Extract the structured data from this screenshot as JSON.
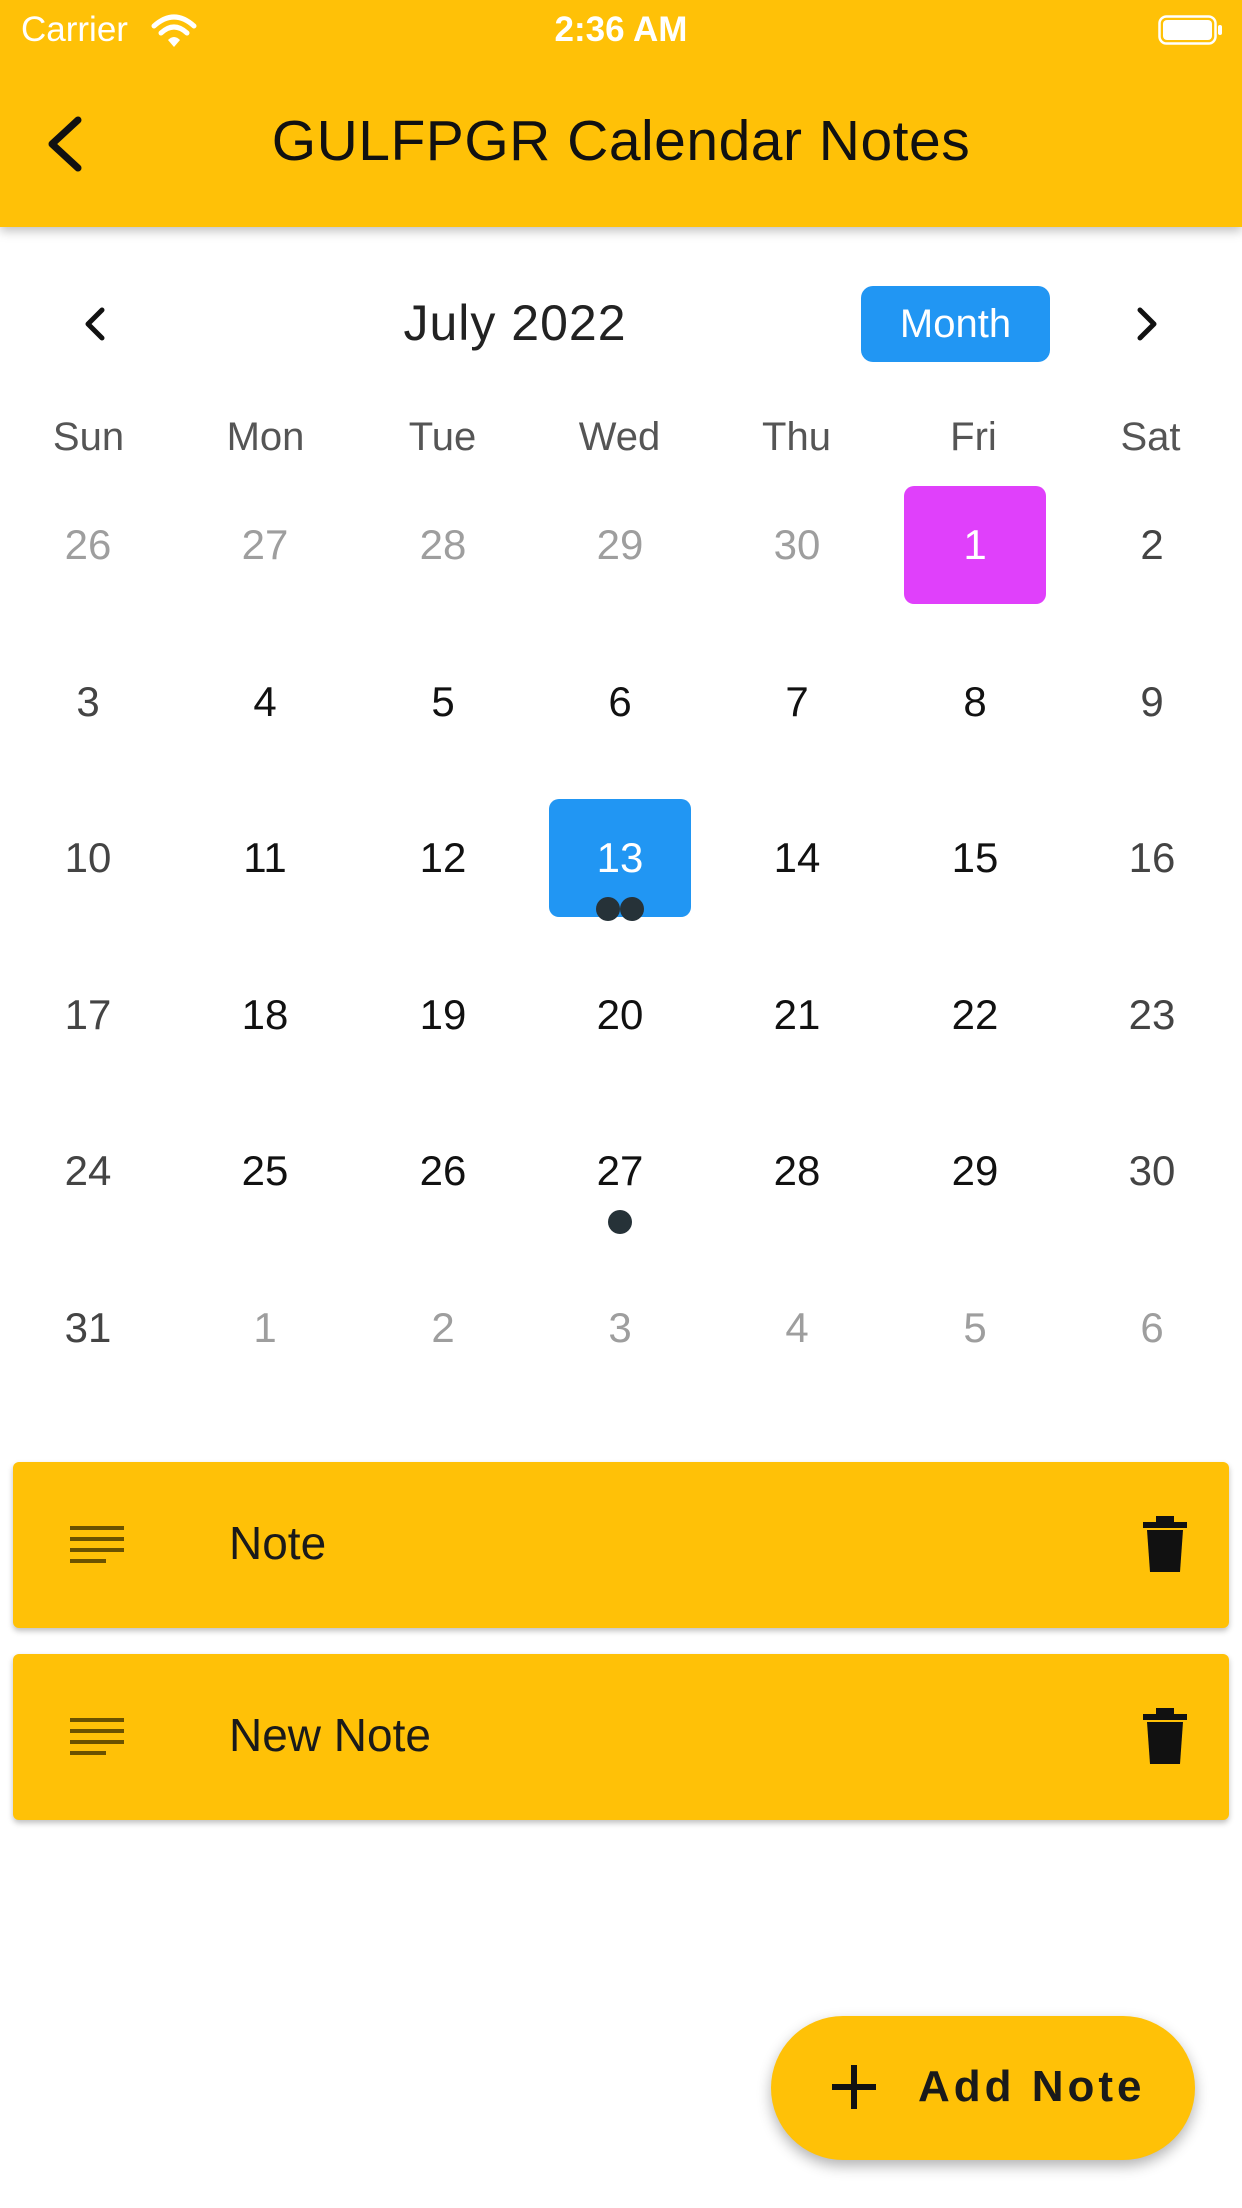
{
  "status_bar": {
    "carrier": "Carrier",
    "time": "2:36 AM",
    "wifi_icon": "wifi-icon",
    "battery_icon": "battery-icon"
  },
  "appbar": {
    "title": "GULFPGR Calendar Notes",
    "back_icon": "back-arrow-icon",
    "color": "#FFC107"
  },
  "calendar": {
    "month_title": "July 2022",
    "format_button": "Month",
    "prev_icon": "chevron-left-icon",
    "next_icon": "chevron-right-icon",
    "weekdays": [
      "Sun",
      "Mon",
      "Tue",
      "Wed",
      "Thu",
      "Fri",
      "Sat"
    ],
    "weeks": [
      [
        "26",
        "27",
        "28",
        "29",
        "30",
        "1",
        "2"
      ],
      [
        "3",
        "4",
        "5",
        "6",
        "7",
        "8",
        "9"
      ],
      [
        "10",
        "11",
        "12",
        "13",
        "14",
        "15",
        "16"
      ],
      [
        "17",
        "18",
        "19",
        "20",
        "21",
        "22",
        "23"
      ],
      [
        "24",
        "25",
        "26",
        "27",
        "28",
        "29",
        "30"
      ],
      [
        "31",
        "1",
        "2",
        "3",
        "4",
        "5",
        "6"
      ]
    ],
    "today_day": "1",
    "selected_day": "13",
    "event_markers": [
      {
        "day": "13",
        "count": 2
      },
      {
        "day": "27",
        "count": 1
      }
    ],
    "colors": {
      "today": "#E040FB",
      "selected": "#2196F3",
      "marker": "#263238",
      "outside_month_text": "#9e9e9e"
    }
  },
  "notes": [
    {
      "title": "Note",
      "lines_icon": "notes-lines-icon",
      "delete_icon": "trash-icon"
    },
    {
      "title": "New Note",
      "lines_icon": "notes-lines-icon",
      "delete_icon": "trash-icon"
    }
  ],
  "fab": {
    "label": "Add Note",
    "icon": "plus-icon"
  }
}
